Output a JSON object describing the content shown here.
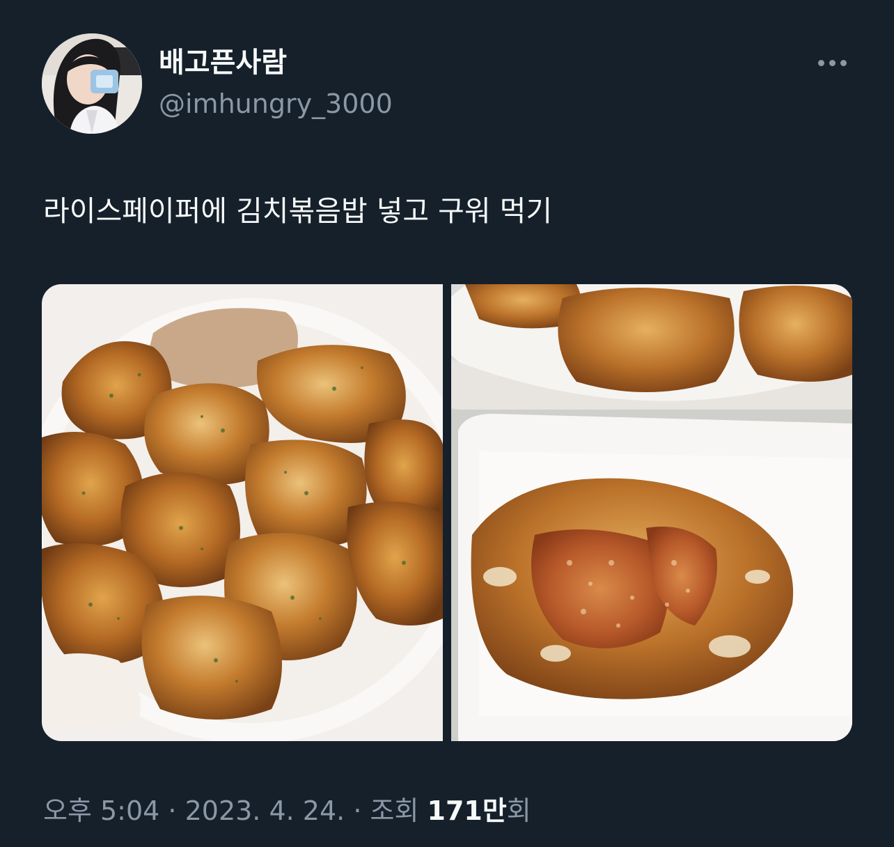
{
  "author": {
    "display_name": "배고픈사람",
    "handle": "@imhungry_3000"
  },
  "tweet": {
    "text": "라이스페이퍼에 김치볶음밥 넣고 구워 먹기"
  },
  "meta": {
    "time": "오후 5:04",
    "separator": " · ",
    "date": "2023. 4. 24.",
    "views_label": "조회",
    "views_count": "171만",
    "views_suffix": "회"
  },
  "colors": {
    "background": "#15202b",
    "primary_text": "#f7f9f9",
    "secondary_text": "#8b98a5"
  },
  "icons": {
    "more": "more-horizontal-icon"
  }
}
